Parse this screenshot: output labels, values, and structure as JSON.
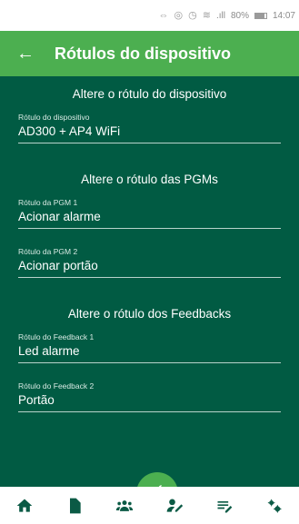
{
  "status_bar": {
    "signal_text": ".ıll",
    "battery_text": "80%",
    "time": "14:07",
    "battery_level": 0.8
  },
  "app_bar": {
    "title": "Rótulos do dispositivo"
  },
  "sections": {
    "device": {
      "title": "Altere o rótulo do dispositivo",
      "field": {
        "label": "Rótulo do dispositivo",
        "value": "AD300 + AP4 WiFi"
      }
    },
    "pgm": {
      "title": "Altere o rótulo das PGMs",
      "fields": [
        {
          "label": "Rótulo da PGM 1",
          "value": "Acionar alarme"
        },
        {
          "label": "Rótulo da PGM 2",
          "value": "Acionar portão"
        }
      ]
    },
    "feedback": {
      "title": "Altere o rótulo dos Feedbacks",
      "fields": [
        {
          "label": "Rótulo do Feedback 1",
          "value": "Led alarme"
        },
        {
          "label": "Rótulo do Feedback 2",
          "value": "Portão"
        }
      ]
    }
  },
  "fab": {
    "icon": "check-icon"
  },
  "bottom_nav": {
    "items": [
      "home-icon",
      "document-icon",
      "users-icon",
      "user-edit-icon",
      "list-edit-icon",
      "settings-icon"
    ]
  },
  "colors": {
    "app_bar": "#4caf50",
    "content_bg": "#015b43",
    "nav_icon": "#0b5a45"
  }
}
